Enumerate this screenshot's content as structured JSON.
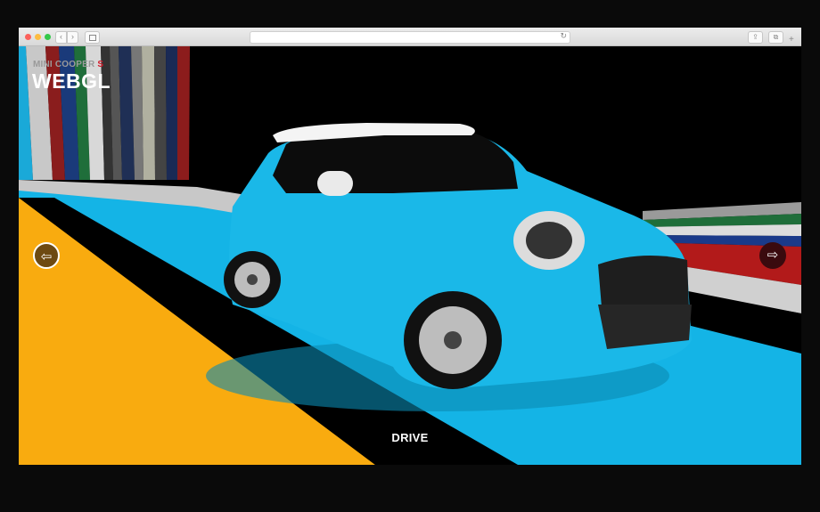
{
  "browser": {
    "nav_back": "‹",
    "nav_forward": "›",
    "url": "",
    "reload_icon": "↻",
    "share_icon": "⇪",
    "tabs_icon": "⧉",
    "new_tab": "+"
  },
  "page": {
    "brand_prefix": "MINI COOPER",
    "brand_suffix": "S",
    "title": "WEBGL",
    "prev_icon": "⇦",
    "next_icon": "⇨",
    "action_label": "DRIVE"
  },
  "colors": {
    "car_body": "#1ab8e8",
    "floor_stripe": "#14b4e6",
    "yellow_panel": "#f9ab0f",
    "brand_accent": "#d21c2c"
  }
}
